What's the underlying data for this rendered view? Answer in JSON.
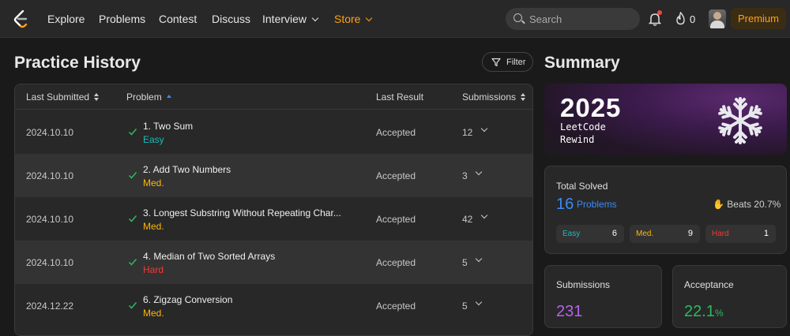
{
  "nav": {
    "items": [
      "Explore",
      "Problems",
      "Contest",
      "Discuss"
    ],
    "interview_label": "Interview",
    "store_label": "Store",
    "search_placeholder": "Search",
    "streak_count": "0",
    "premium_label": "Premium"
  },
  "history": {
    "title": "Practice History",
    "filter_label": "Filter",
    "columns": {
      "last_submitted": "Last Submitted",
      "problem": "Problem",
      "last_result": "Last Result",
      "submissions": "Submissions"
    },
    "rows": [
      {
        "date": "2024.10.10",
        "problem": "1. Two Sum",
        "difficulty": "Easy",
        "result": "Accepted",
        "submissions": "12"
      },
      {
        "date": "2024.10.10",
        "problem": "2. Add Two Numbers",
        "difficulty": "Med.",
        "result": "Accepted",
        "submissions": "3"
      },
      {
        "date": "2024.10.10",
        "problem": "3. Longest Substring Without Repeating Char...",
        "difficulty": "Med.",
        "result": "Accepted",
        "submissions": "42"
      },
      {
        "date": "2024.10.10",
        "problem": "4. Median of Two Sorted Arrays",
        "difficulty": "Hard",
        "result": "Accepted",
        "submissions": "5"
      },
      {
        "date": "2024.12.22",
        "problem": "6. Zigzag Conversion",
        "difficulty": "Med.",
        "result": "Accepted",
        "submissions": "5"
      }
    ]
  },
  "summary": {
    "title": "Summary",
    "banner": {
      "year": "2025",
      "line1": "LeetCode",
      "line2": "Rewind"
    },
    "total_solved": {
      "label": "Total Solved",
      "count": "16",
      "unit": "Problems",
      "beats": "Beats 20.7%",
      "easy_label": "Easy",
      "easy_count": "6",
      "med_label": "Med.",
      "med_count": "9",
      "hard_label": "Hard",
      "hard_count": "1"
    },
    "submissions": {
      "label": "Submissions",
      "value": "231"
    },
    "acceptance": {
      "label": "Acceptance",
      "value": "22.1",
      "unit": "%"
    }
  },
  "colors": {
    "easy": "#1cbaba",
    "medium": "#ffb800",
    "hard": "#f63737",
    "accent": "#ffa116",
    "accepted": "#2cbb5d"
  }
}
